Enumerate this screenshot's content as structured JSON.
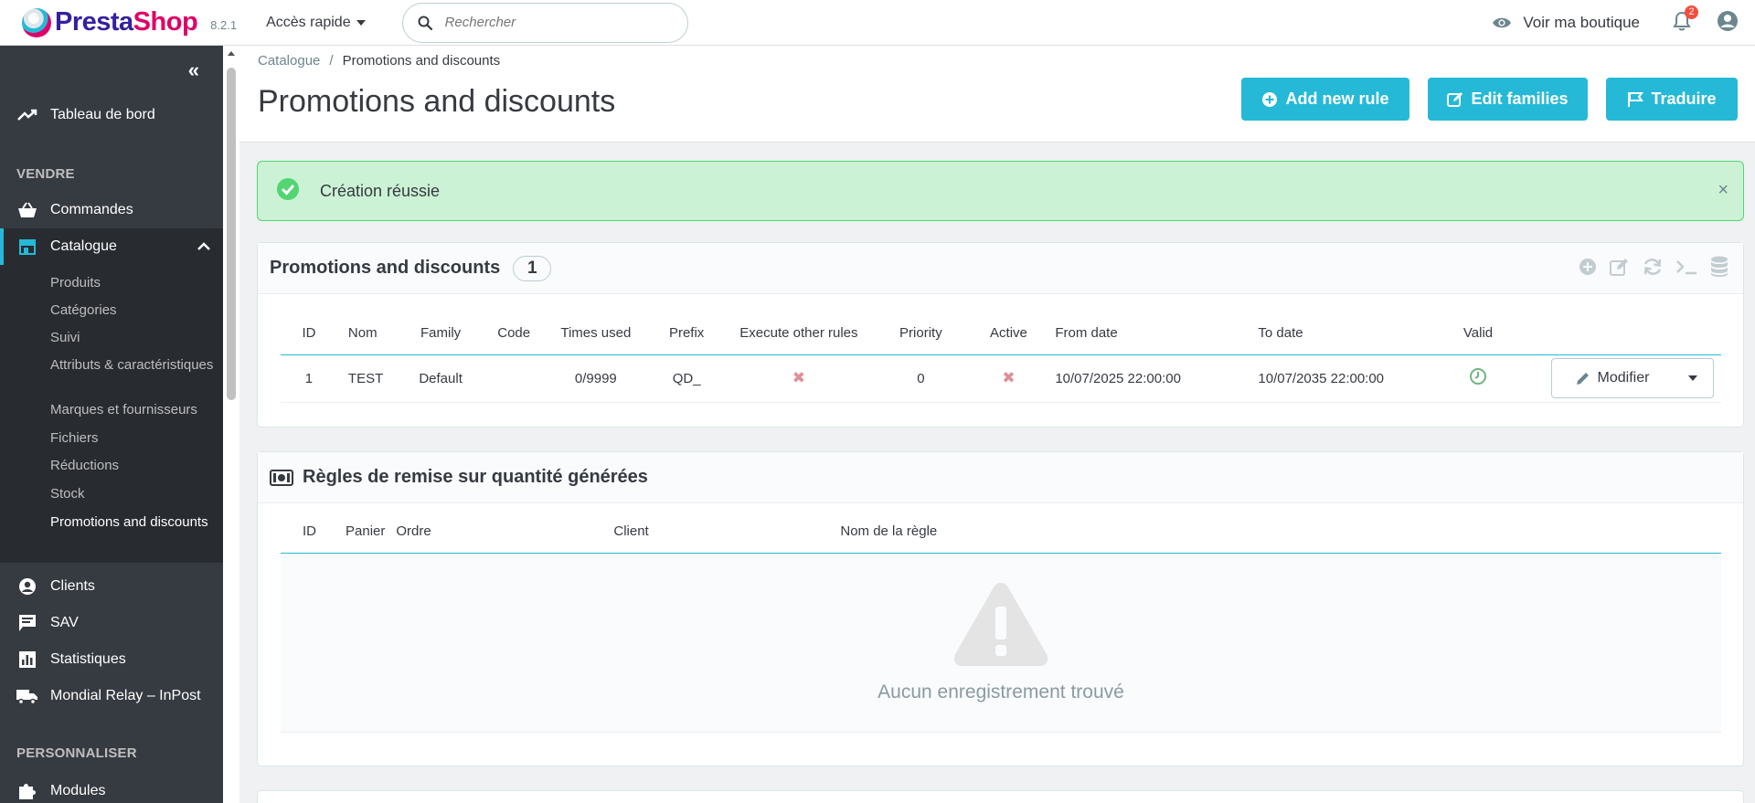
{
  "app": {
    "brand_a": "Presta",
    "brand_b": "Shop",
    "version": "8.2.1",
    "quick_access": "Accès rapide",
    "search_placeholder": "Rechercher",
    "view_shop": "Voir ma boutique",
    "notifications_count": "2"
  },
  "sidebar": {
    "dashboard": "Tableau de bord",
    "section_sell": "VENDRE",
    "orders": "Commandes",
    "catalogue": "Catalogue",
    "sub": [
      "Produits",
      "Catégories",
      "Suivi",
      "Attributs & caractéristiques",
      "Marques et fournisseurs",
      "Fichiers",
      "Réductions",
      "Stock",
      "Promotions and discounts"
    ],
    "customers": "Clients",
    "sav": "SAV",
    "stats": "Statistiques",
    "mondial": "Mondial Relay – InPost",
    "section_custom": "PERSONNALISER",
    "modules": "Modules"
  },
  "header": {
    "breadcrumb_parent": "Catalogue",
    "breadcrumb_sep": "/",
    "breadcrumb_current": "Promotions and discounts",
    "title": "Promotions and discounts",
    "btn_add": "Add new rule",
    "btn_edit": "Edit families",
    "btn_translate": "Traduire"
  },
  "alert": {
    "text": "Création réussie"
  },
  "panel1": {
    "title": "Promotions and discounts",
    "count": "1",
    "columns": [
      "ID",
      "Nom",
      "Family",
      "Code",
      "Times used",
      "Prefix",
      "Execute other rules",
      "Priority",
      "Active",
      "From date",
      "To date",
      "Valid"
    ],
    "row": {
      "id": "1",
      "nom": "TEST",
      "family": "Default",
      "code": "",
      "times_used": "0/9999",
      "prefix": "QD_",
      "execute": "✖",
      "priority": "0",
      "active": "✖",
      "from": "10/07/2025 22:00:00",
      "to": "10/07/2035 22:00:00",
      "action": "Modifier"
    }
  },
  "panel2": {
    "title": "Règles de remise sur quantité générées",
    "columns": [
      "ID",
      "Panier",
      "Ordre",
      "Client",
      "Nom de la règle"
    ],
    "empty": "Aucun enregistrement trouvé"
  },
  "colors": {
    "accent": "#25b9d7",
    "success_bg": "#cbf2d4",
    "sidebar_bg": "#363a41"
  }
}
